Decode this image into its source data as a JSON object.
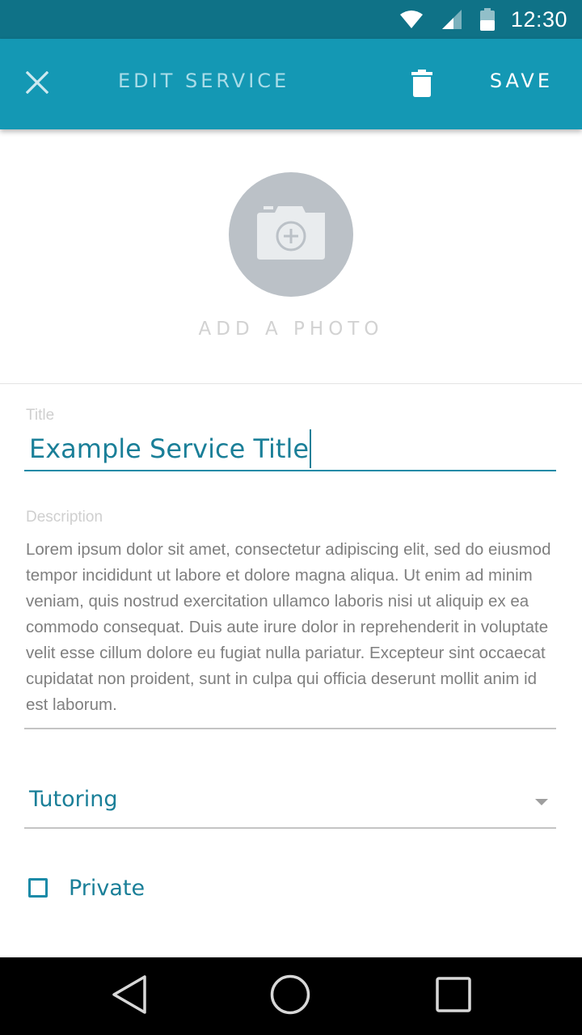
{
  "status_bar": {
    "time": "12:30"
  },
  "app_bar": {
    "title": "EDIT SERVICE",
    "save_label": "SAVE"
  },
  "photo": {
    "label": "ADD A PHOTO"
  },
  "form": {
    "title_label": "Title",
    "title_value": "Example Service Title",
    "description_label": "Description",
    "description_value": "Lorem ipsum dolor sit amet, consectetur adipiscing elit, sed do eiusmod tempor incididunt ut labore et dolore magna aliqua. Ut enim ad minim veniam, quis nostrud exercitation ullamco laboris nisi ut aliquip ex ea commodo consequat. Duis aute irure dolor in reprehenderit in voluptate velit esse cillum dolore eu fugiat nulla pariatur. Excepteur sint occaecat cupidatat non proident, sunt in culpa qui officia deserunt mollit anim id est laborum.",
    "category_value": "Tutoring",
    "private_label": "Private",
    "private_checked": false
  },
  "icons": {
    "close": "close-icon",
    "delete": "trash-icon",
    "camera": "add-photo-icon",
    "wifi": "wifi-icon",
    "signal": "cell-signal-icon",
    "battery": "battery-icon",
    "back": "back-triangle-icon",
    "home": "home-circle-icon",
    "recents": "recents-square-icon"
  },
  "colors": {
    "status_bar": "#0f7287",
    "app_bar": "#1498b4",
    "accent": "#1a8aa7",
    "photo_circle": "#bbc1c7"
  }
}
